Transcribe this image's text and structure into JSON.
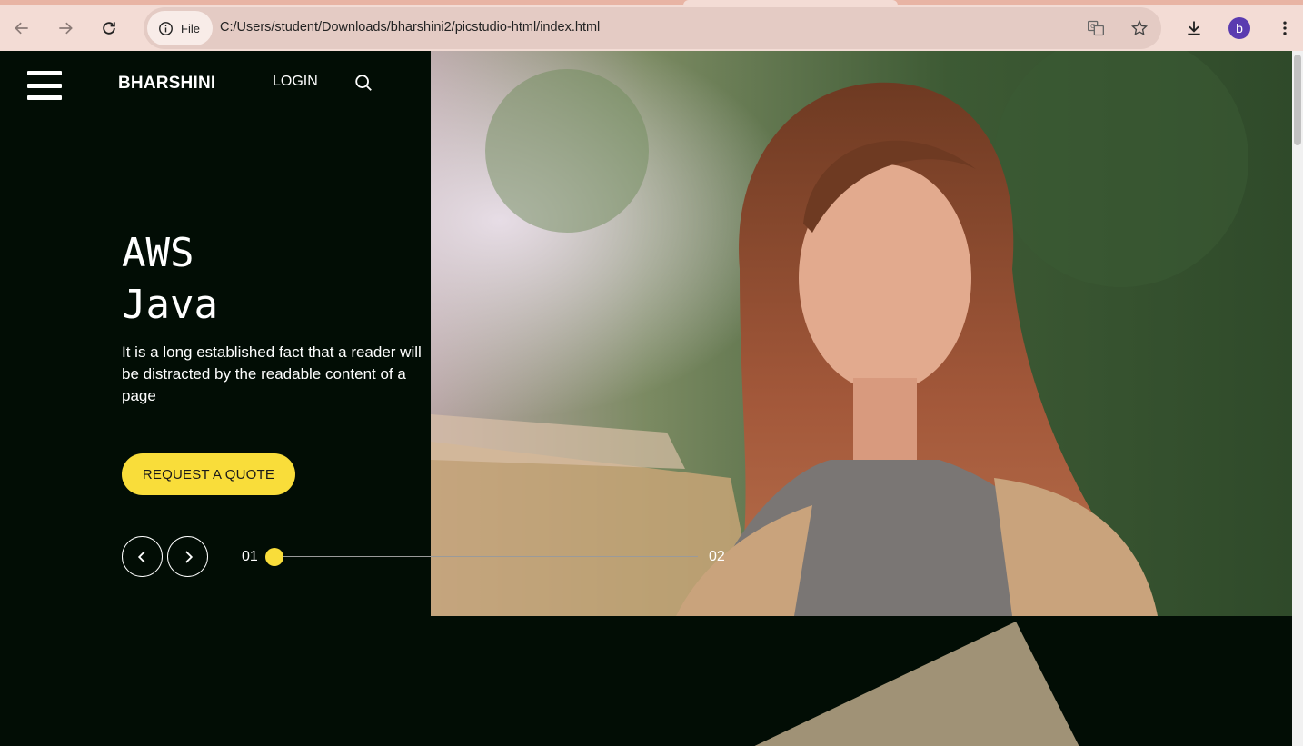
{
  "browser": {
    "file_chip_label": "File",
    "url": "C:/Users/student/Downloads/bharshini2/picstudio-html/index.html",
    "profile_initial": "b"
  },
  "header": {
    "brand": "BHARSHINI",
    "login_label": "LOGIN"
  },
  "hero": {
    "headline_line1": "AWS",
    "headline_line2": "Java",
    "description": "It is a long established fact that a reader will be distracted by the readable content of a page",
    "cta_label": "REQUEST A QUOTE"
  },
  "slider": {
    "current": "01",
    "next": "02",
    "progress": 0.0
  },
  "colors": {
    "background": "#020d05",
    "accent": "#f9dd3a",
    "deco_shape": "#a09276"
  },
  "icons": [
    "back-icon",
    "forward-icon",
    "reload-icon",
    "info-icon",
    "translate-icon",
    "star-icon",
    "download-icon",
    "more-icon",
    "menu-icon",
    "search-icon",
    "chevron-left-icon",
    "chevron-right-icon"
  ]
}
